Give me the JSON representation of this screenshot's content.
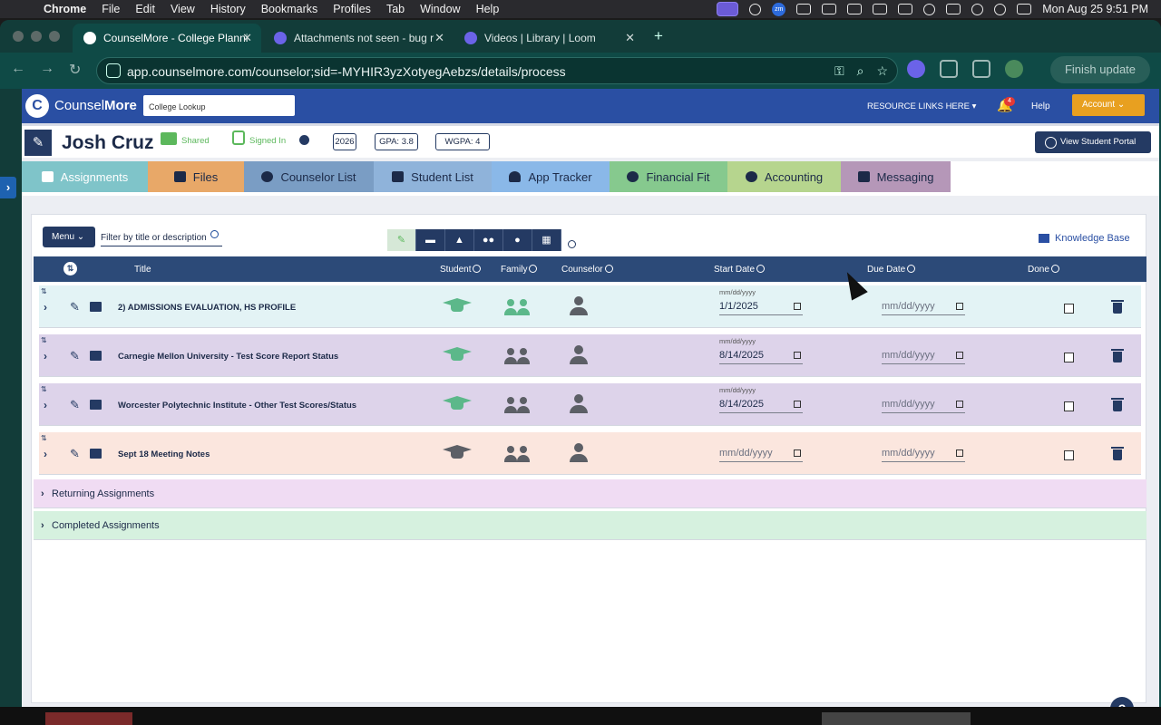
{
  "menubar": {
    "app": "Chrome",
    "items": [
      "File",
      "Edit",
      "View",
      "History",
      "Bookmarks",
      "Profiles",
      "Tab",
      "Window",
      "Help"
    ],
    "zoom_icon_label": "zm",
    "datetime": "Mon Aug 25  9:51 PM"
  },
  "browser": {
    "tabs": [
      {
        "label": "CounselMore - College Planni",
        "active": true
      },
      {
        "label": "Attachments not seen - bug r",
        "active": false
      },
      {
        "label": "Videos | Library | Loom",
        "active": false
      }
    ],
    "url": "app.counselmore.com/counselor;sid=-MYHIR3yzXotyegAebzs/details/process",
    "finish_update": "Finish update"
  },
  "app": {
    "brand_light": "Counsel",
    "brand_bold": "More",
    "college_lookup": "College Lookup",
    "resource_links": "RESOURCE LINKS HERE ▾",
    "notification_count": "4",
    "help": "Help",
    "account": "Account"
  },
  "student": {
    "name": "Josh Cruz",
    "shared": "Shared",
    "signed_in": "Signed In",
    "year": "2026",
    "gpa": "GPA: 3.8",
    "wgpa": "WGPA: 4",
    "view_portal": "View Student Portal"
  },
  "tabs": [
    {
      "label": "Assignments",
      "color": "#7fc4c9"
    },
    {
      "label": "Files",
      "color": "#e8a868"
    },
    {
      "label": "Counselor List",
      "color": "#7a9dc4"
    },
    {
      "label": "Student List",
      "color": "#8fb3da"
    },
    {
      "label": "App Tracker",
      "color": "#8ab8e8"
    },
    {
      "label": "Financial Fit",
      "color": "#86c98e"
    },
    {
      "label": "Accounting",
      "color": "#b6d58e"
    },
    {
      "label": "Messaging",
      "color": "#b597b8"
    }
  ],
  "toolbar": {
    "menu": "Menu",
    "filter_placeholder": "Filter by title or description",
    "knowledge_base": "Knowledge Base"
  },
  "table": {
    "headers": {
      "title": "Title",
      "student": "Student",
      "family": "Family",
      "counselor": "Counselor",
      "start": "Start Date",
      "due": "Due Date",
      "done": "Done"
    },
    "date_label": "mm/dd/yyyy",
    "rows": [
      {
        "title": "2) ADMISSIONS EVALUATION, HS PROFILE",
        "start": "1/1/2025",
        "due": "mm/dd/yyyy",
        "bg": "#e3f3f5",
        "student_color": "#5cb88a",
        "family_color": "#5cb88a"
      },
      {
        "title": "Carnegie Mellon University - Test Score Report Status",
        "start": "8/14/2025",
        "due": "mm/dd/yyyy",
        "bg": "#ddd3ea",
        "student_color": "#5cb88a",
        "family_color": "#5c5f66"
      },
      {
        "title": "Worcester Polytechnic Institute - Other Test Scores/Status",
        "start": "8/14/2025",
        "due": "mm/dd/yyyy",
        "bg": "#ddd3ea",
        "student_color": "#5cb88a",
        "family_color": "#5c5f66"
      },
      {
        "title": "Sept 18 Meeting Notes",
        "start": "mm/dd/yyyy",
        "due": "mm/dd/yyyy",
        "bg": "#fbe6de",
        "student_color": "#5c5f66",
        "family_color": "#5c5f66"
      }
    ]
  },
  "sections": [
    {
      "label": "Returning Assignments",
      "bg": "#f0dcf3"
    },
    {
      "label": "Completed Assignments",
      "bg": "#d6f1df"
    }
  ],
  "help_fab": "?"
}
